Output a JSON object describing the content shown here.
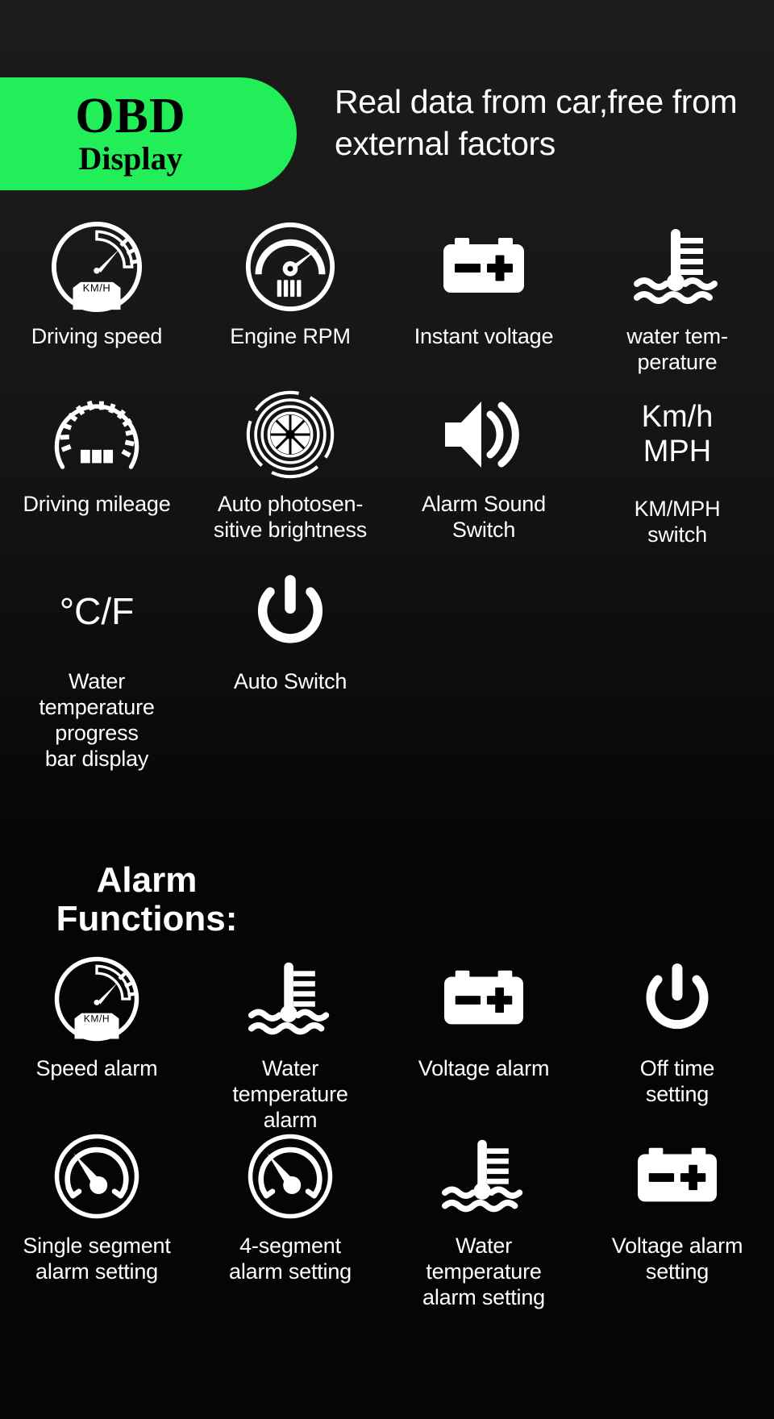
{
  "header": {
    "badge_line1": "OBD",
    "badge_line2": "Display",
    "badge_color": "#22ee5a",
    "tagline": "Real data from car,free from external factors"
  },
  "section_title": {
    "line1": "Alarm",
    "line2": "Functions:"
  },
  "features": {
    "row1": [
      {
        "icon": "speedometer-kmh-icon",
        "label": "Driving speed"
      },
      {
        "icon": "engine-rpm-gauge-icon",
        "label": "Engine RPM"
      },
      {
        "icon": "car-battery-icon",
        "label": "Instant voltage"
      },
      {
        "icon": "water-temperature-icon",
        "label": "water tem-\nperature"
      }
    ],
    "row2": [
      {
        "icon": "odometer-dial-icon",
        "label": "Driving mileage"
      },
      {
        "icon": "aperture-turbine-icon",
        "label": "Auto photosen-\nsitive brightness"
      },
      {
        "icon": "speaker-sound-icon",
        "label": "Alarm Sound\nSwitch"
      },
      {
        "icon": "kmh-mph-text-icon",
        "glyph_line1": "Km/h",
        "glyph_line2": "MPH",
        "label": "KM/MPH\nswitch"
      }
    ],
    "row3": [
      {
        "icon": "celsius-fahrenheit-text-icon",
        "glyph": "°C/F",
        "label": "Water\ntemperature\nprogress\nbar display"
      },
      {
        "icon": "power-switch-icon",
        "label": "Auto Switch"
      }
    ]
  },
  "alarm_functions": {
    "row1": [
      {
        "icon": "speedometer-kmh-icon",
        "label": "Speed alarm"
      },
      {
        "icon": "water-temperature-icon",
        "label": "Water\ntemperature\nalarm"
      },
      {
        "icon": "car-battery-icon",
        "label": "Voltage alarm"
      },
      {
        "icon": "power-switch-icon",
        "label": "Off time\nsetting"
      }
    ],
    "row2": [
      {
        "icon": "needle-gauge-icon",
        "label": "Single segment\nalarm setting"
      },
      {
        "icon": "needle-gauge-icon",
        "label": "4-segment\nalarm setting"
      },
      {
        "icon": "water-temperature-icon",
        "label": "Water\ntemperature\nalarm setting"
      },
      {
        "icon": "car-battery-icon",
        "label": "Voltage alarm\nsetting"
      }
    ]
  },
  "colors": {
    "background": "#000000",
    "background_top": "#1a1a1a",
    "accent_green": "#22ee5a",
    "text": "#ffffff"
  }
}
